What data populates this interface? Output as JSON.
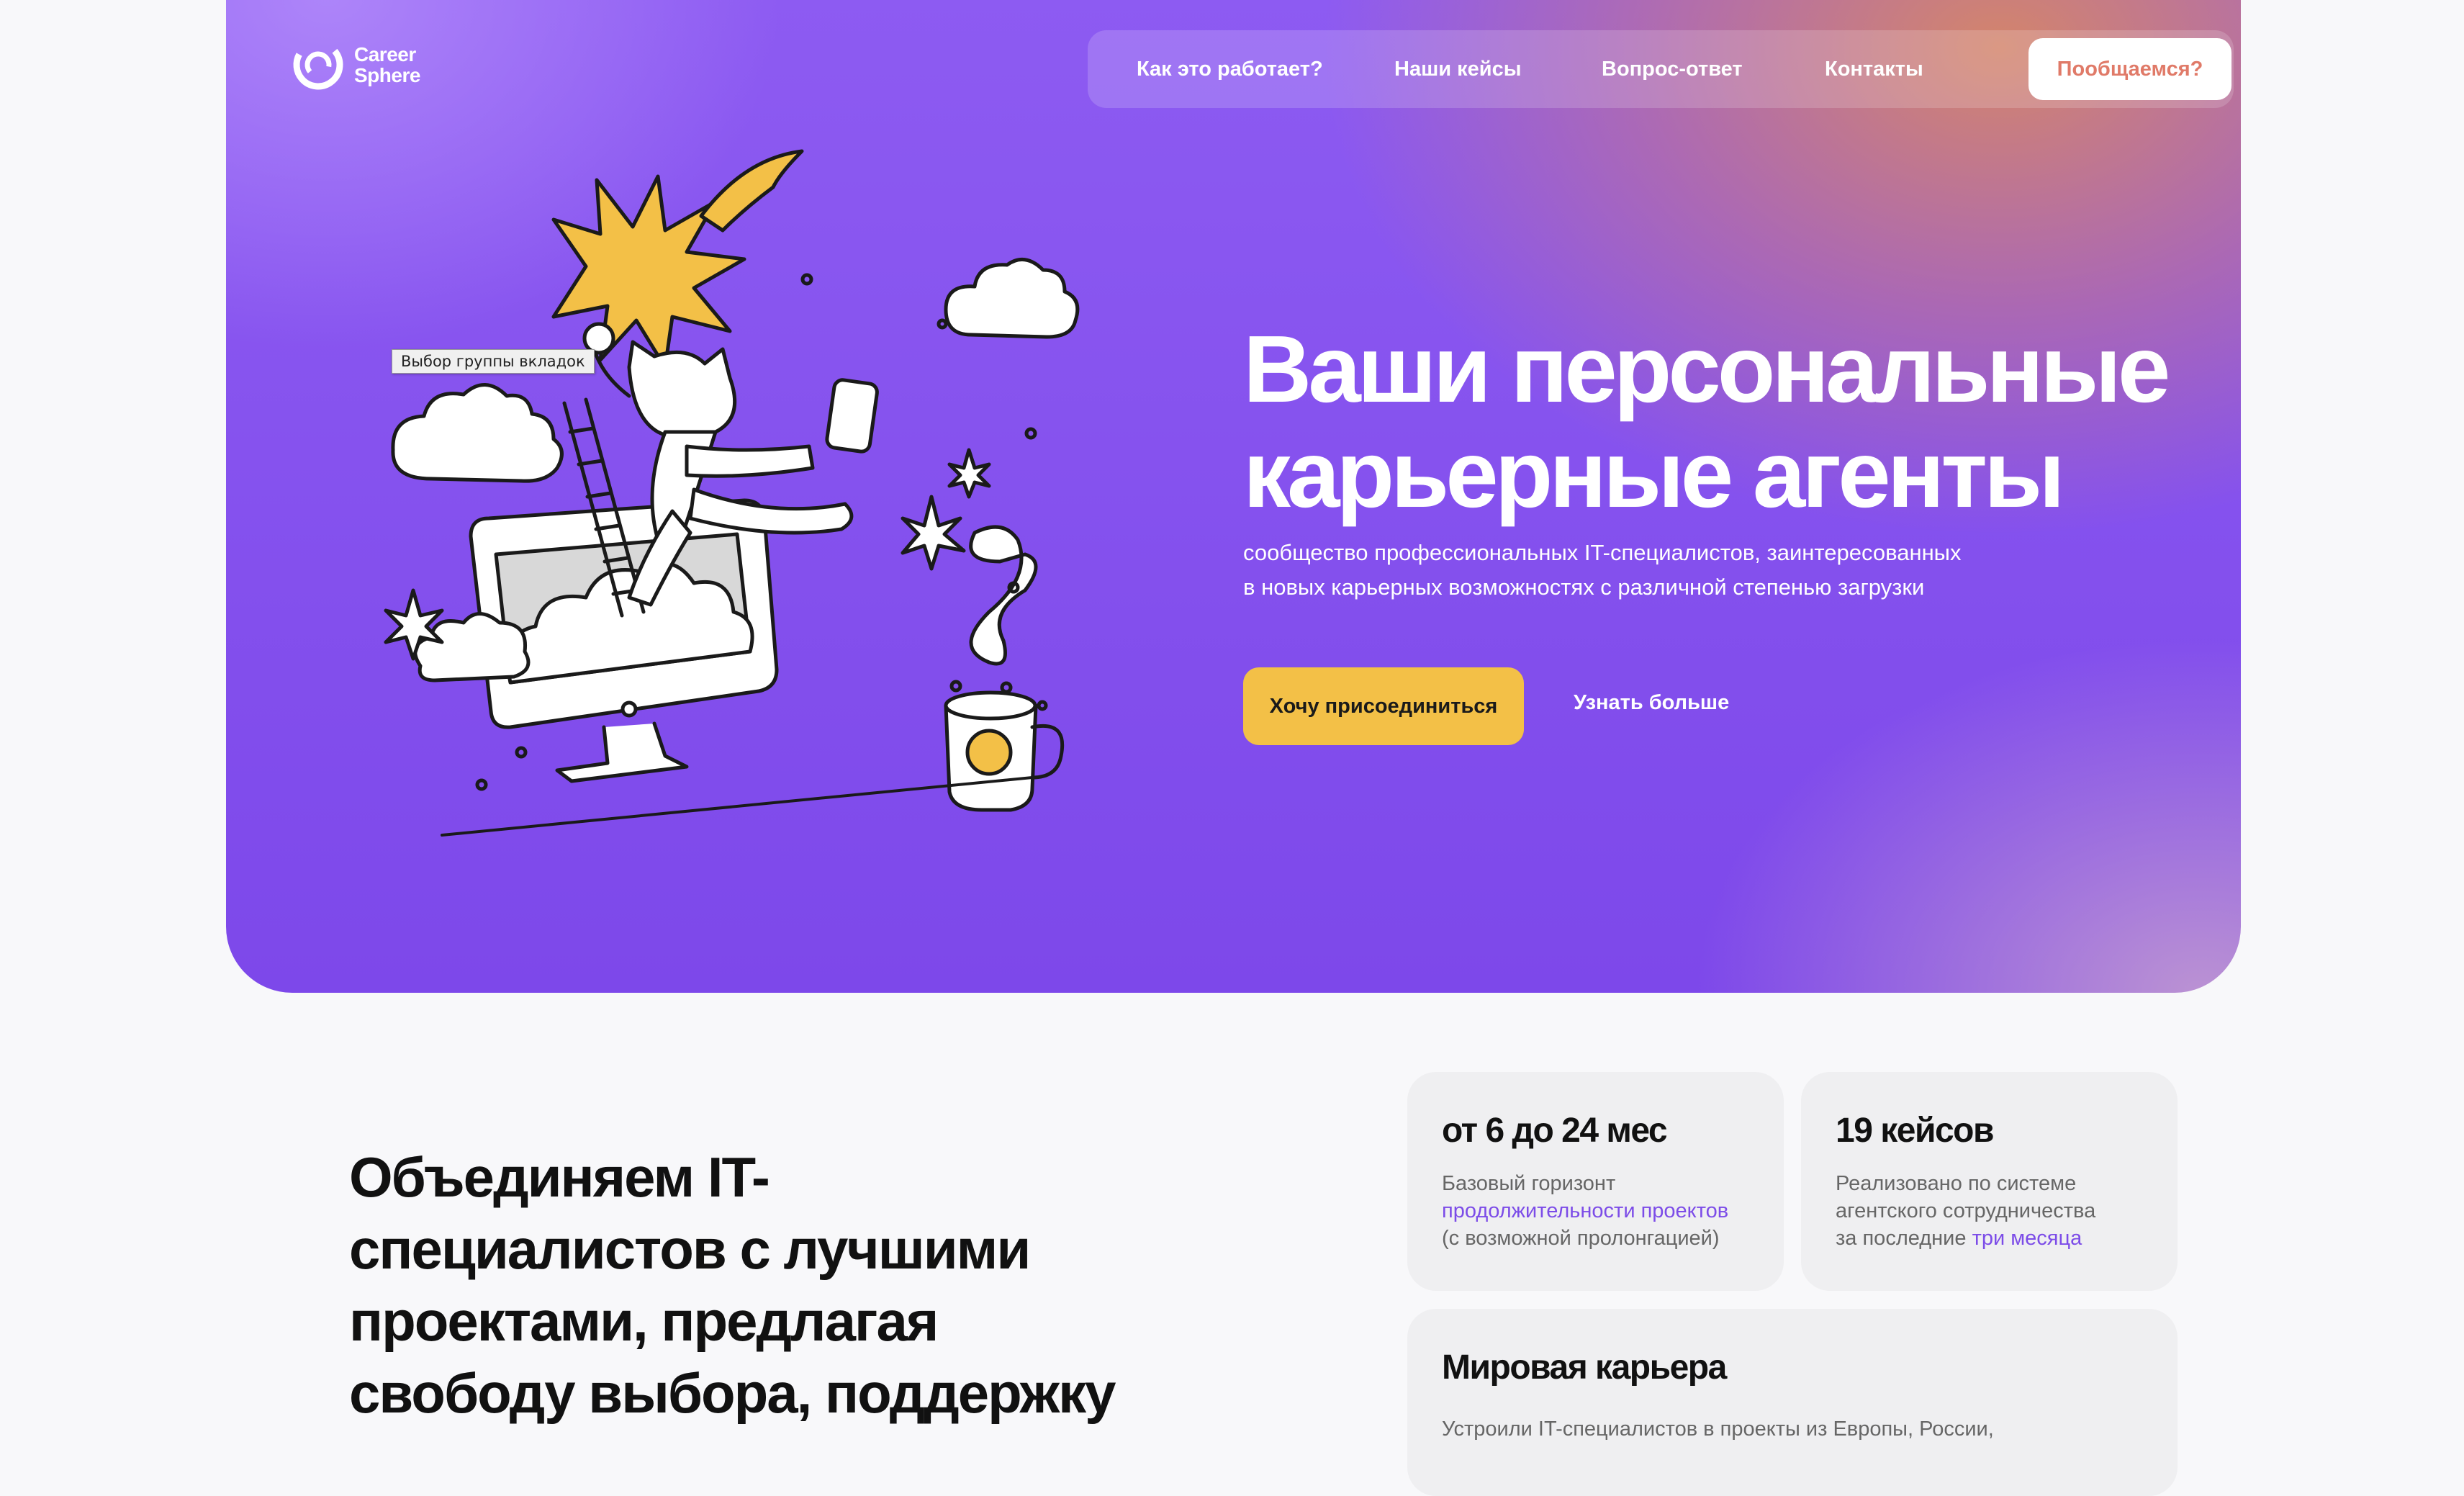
{
  "brand": {
    "line1": "Career",
    "line2": "Sphere"
  },
  "nav": {
    "items": [
      "Как это работает?",
      "Наши кейсы",
      "Вопрос-ответ",
      "Контакты"
    ],
    "cta": "Пообщаемся?"
  },
  "tooltip": "Выбор группы вкладок",
  "hero": {
    "title_line1": "Ваши персональные",
    "title_line2": "карьерные агенты",
    "subtitle_line1": "сообщество профессиональных IT-специалистов, заинтересованных",
    "subtitle_line2": "в новых карьерных возможностях с различной степенью загрузки",
    "primary_button": "Хочу присоединиться",
    "secondary_link": "Узнать больше"
  },
  "about": {
    "heading_lines": [
      "Объединяем IT-",
      "специалистов с лучшими",
      "проектами, предлагая",
      "свободу выбора, поддержку"
    ]
  },
  "cards": [
    {
      "title": "от 6 до 24 мес",
      "line1": "Базовый горизонт",
      "line2_accent": "продолжительности проектов",
      "line3": "(с возможной пролонгацией)"
    },
    {
      "title": "19 кейсов",
      "line1": "Реализовано по системе",
      "line2": "агентского сотрудничества",
      "line3": "за последние ",
      "line3_accent": "три месяца"
    },
    {
      "title": "Мировая карьера",
      "line1": "Устроили IT-специалистов в проекты из Европы, России,"
    }
  ],
  "colors": {
    "accent_purple": "#7c4ce8",
    "button_yellow": "#f3c047",
    "cta_text": "#e07a68",
    "page_bg": "#f8f8fa"
  }
}
